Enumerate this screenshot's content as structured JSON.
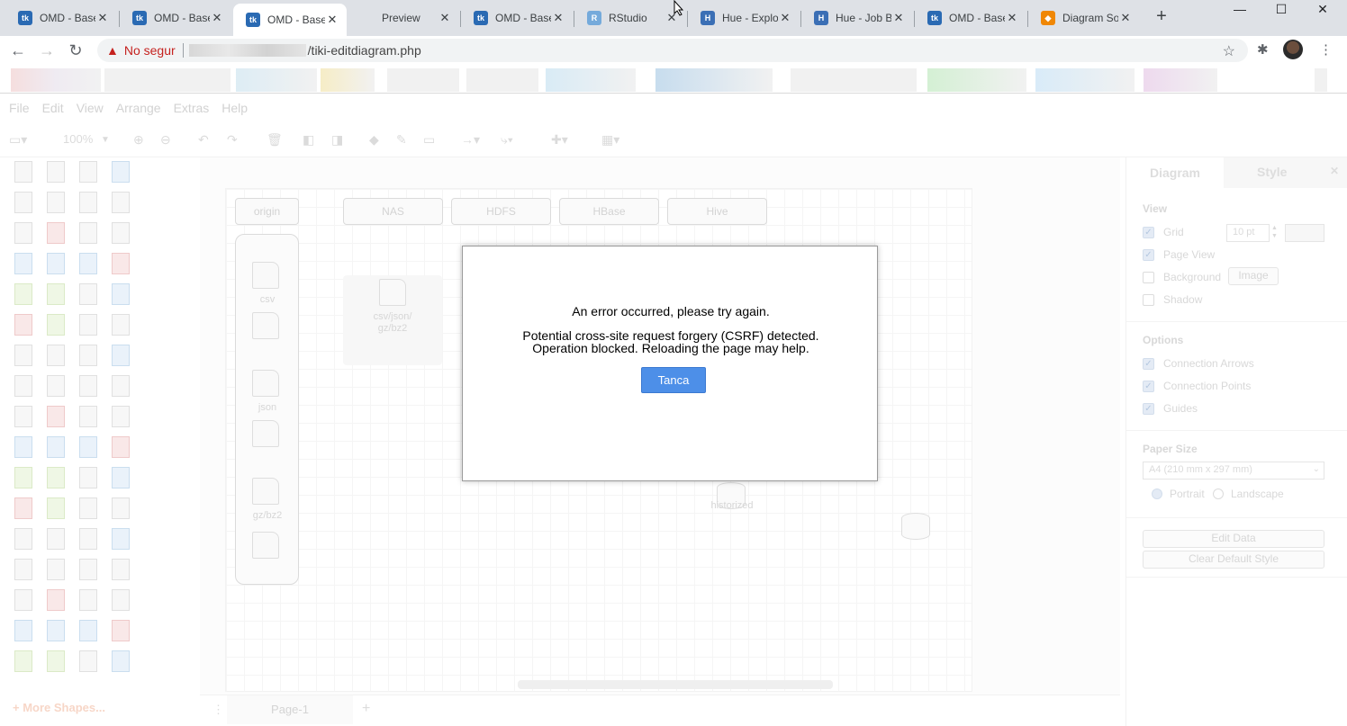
{
  "browser": {
    "tabs": [
      {
        "title": "OMD - Base",
        "favicon": "tiki"
      },
      {
        "title": "OMD - Base",
        "favicon": "tiki"
      },
      {
        "title": "OMD - Base",
        "favicon": "tiki",
        "active": true
      },
      {
        "title": "Preview",
        "favicon": "none"
      },
      {
        "title": "OMD - Base",
        "favicon": "tiki"
      },
      {
        "title": "RStudio",
        "favicon": "R"
      },
      {
        "title": "Hue - Explo",
        "favicon": "hue"
      },
      {
        "title": "Hue - Job B",
        "favicon": "hue"
      },
      {
        "title": "OMD - Base",
        "favicon": "tiki"
      },
      {
        "title": "Diagram So",
        "favicon": "drawio"
      }
    ],
    "new_tab_label": "+",
    "window_controls": {
      "minimize": "—",
      "maximize": "☐",
      "close": "✕"
    },
    "address": {
      "security_label": "No segur",
      "path": "/tiki-editdiagram.php"
    },
    "colors": {
      "tab_strip": "#dee1e6",
      "warning": "#c5221f"
    }
  },
  "app": {
    "menu": [
      "File",
      "Edit",
      "View",
      "Arrange",
      "Extras",
      "Help"
    ],
    "zoom": "100%",
    "canvas": {
      "lanes": [
        "origin",
        "NAS",
        "HDFS",
        "HBase",
        "Hive"
      ],
      "docs": [
        "csv",
        "json",
        "gz/bz2"
      ],
      "nas_doc_label": "csv/json/\ngz/bz2",
      "store_label": "historized"
    },
    "sidebar": {
      "more_shapes": "+ More Shapes..."
    },
    "page_tab": "Page-1",
    "format_panel": {
      "tabs": [
        "Diagram",
        "Style"
      ],
      "view_title": "View",
      "view_options": [
        {
          "label": "Grid",
          "checked": true
        },
        {
          "label": "Page View",
          "checked": true
        },
        {
          "label": "Background",
          "checked": false
        },
        {
          "label": "Shadow",
          "checked": false
        }
      ],
      "grid_size": "10 pt",
      "image_button": "Image",
      "options_title": "Options",
      "options": [
        {
          "label": "Connection Arrows",
          "checked": true
        },
        {
          "label": "Connection Points",
          "checked": true
        },
        {
          "label": "Guides",
          "checked": true
        }
      ],
      "paper_size_title": "Paper Size",
      "paper_size": "A4 (210 mm x 297 mm)",
      "orientation": [
        "Portrait",
        "Landscape"
      ],
      "edit_data": "Edit Data",
      "clear_style": "Clear Default Style"
    }
  },
  "dialog": {
    "title": "An error occurred, please try again.",
    "message_line1": "Potential cross-site request forgery (CSRF) detected.",
    "message_line2": "Operation blocked. Reloading the page may help.",
    "button": "Tanca",
    "button_color": "#4d8fe8"
  }
}
